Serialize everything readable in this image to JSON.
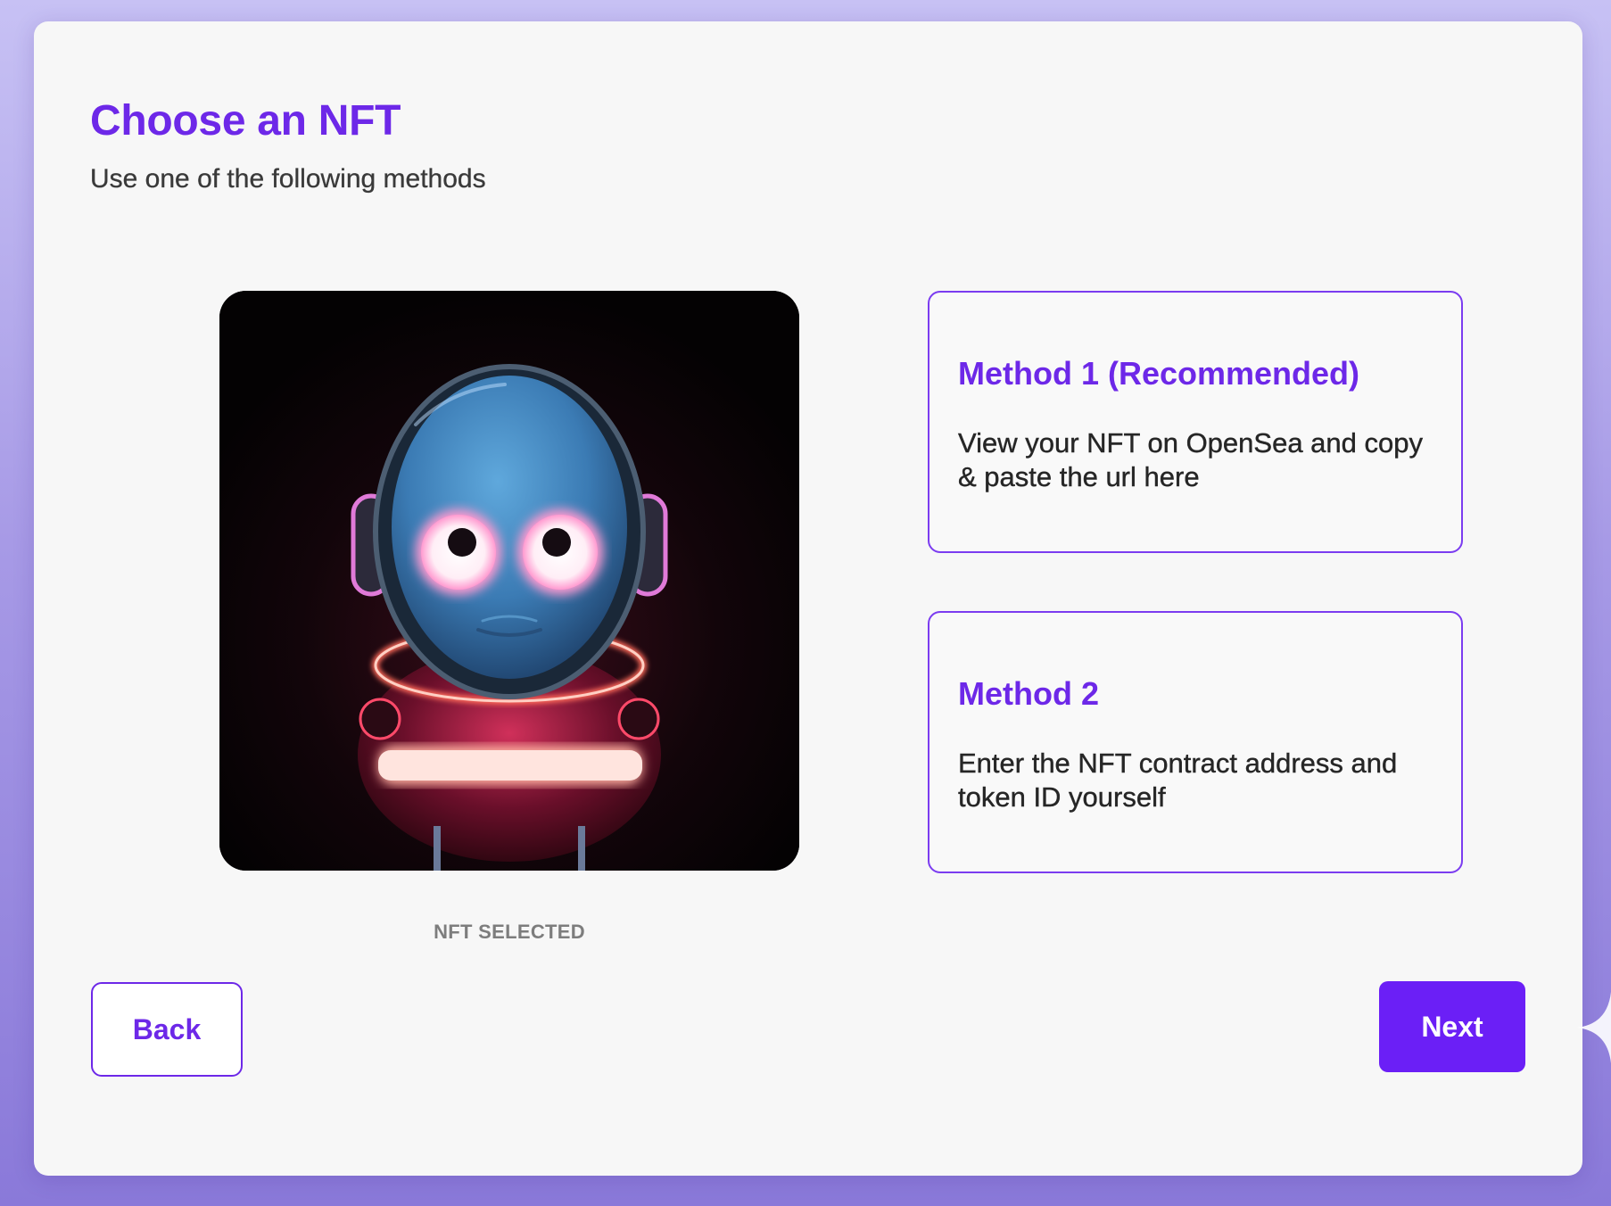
{
  "header": {
    "title": "Choose an NFT",
    "subtitle": "Use one of the following methods"
  },
  "nft": {
    "caption": "NFT SELECTED",
    "image": "astronaut-character-image"
  },
  "methods": [
    {
      "title": "Method 1 (Recommended)",
      "description": "View your NFT on OpenSea and copy & paste the url here"
    },
    {
      "title": "Method 2",
      "description": "Enter the NFT contract address and token ID yourself"
    }
  ],
  "nav": {
    "back_label": "Back",
    "next_label": "Next"
  },
  "colors": {
    "accent": "#6d28e8",
    "next_button": "#6b1ff6",
    "background_top": "#c7c1f4",
    "background_bottom": "#8a79d9"
  }
}
